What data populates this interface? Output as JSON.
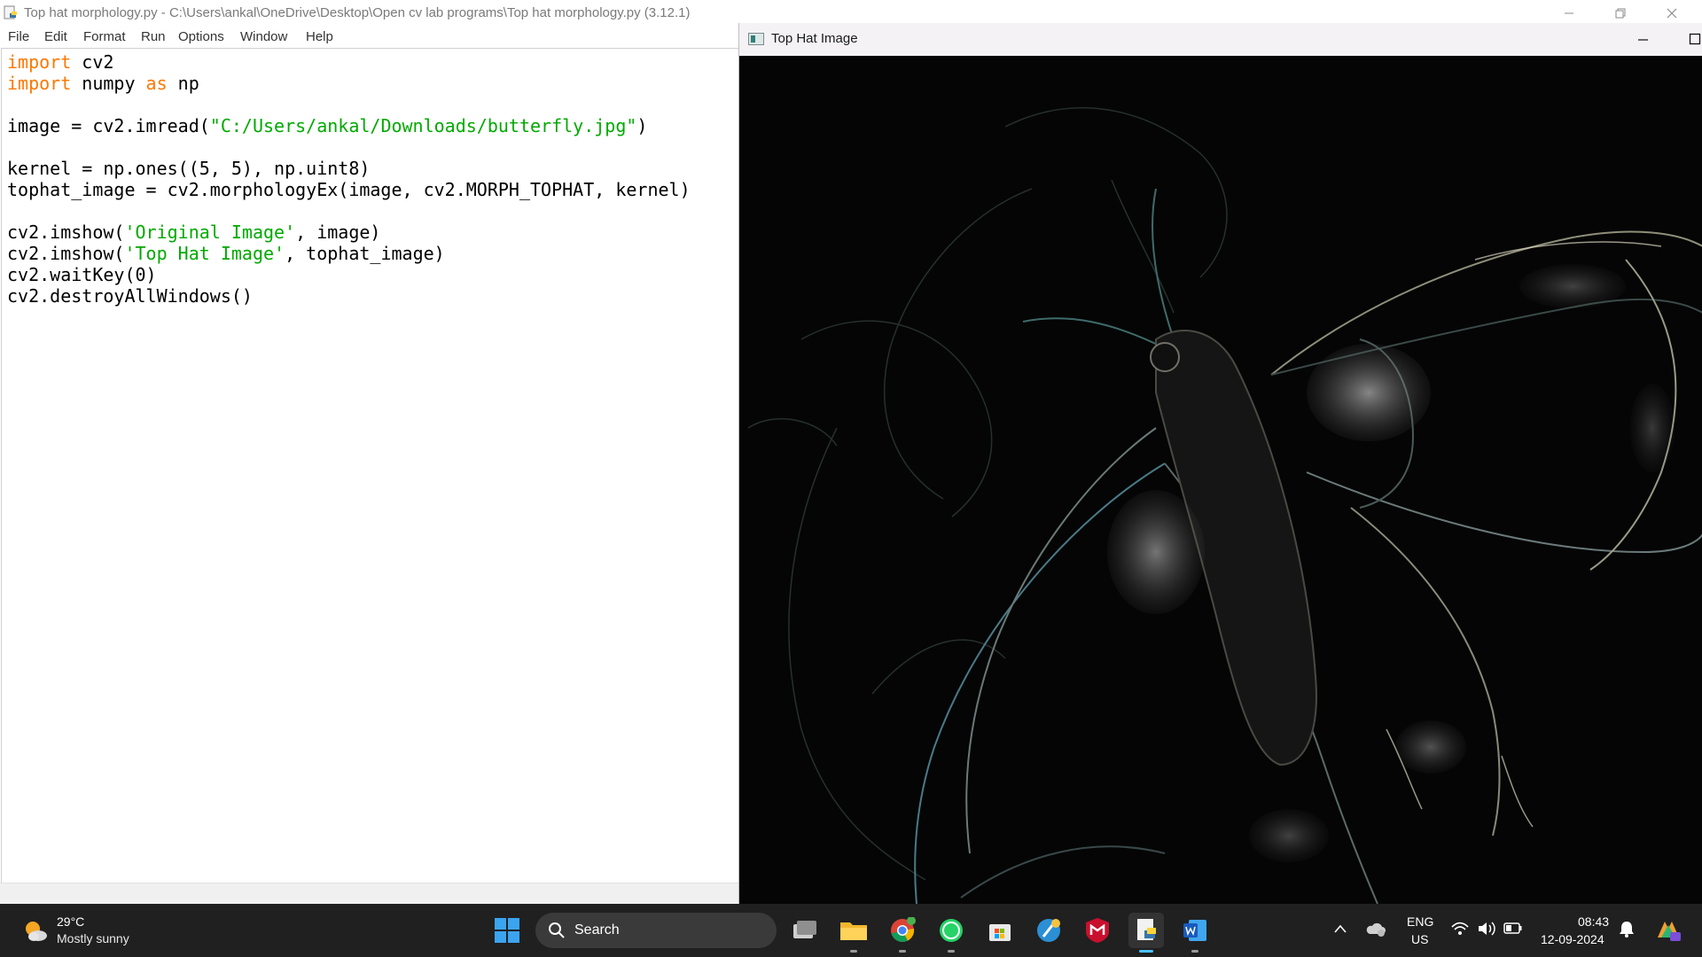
{
  "editor_window": {
    "title": "Top hat morphology.py - C:\\Users\\ankal\\OneDrive\\Desktop\\Open cv lab programs\\Top hat morphology.py (3.12.1)",
    "menu": [
      "File",
      "Edit",
      "Format",
      "Run",
      "Options",
      "Window",
      "Help"
    ]
  },
  "code": {
    "line1_kw": "import",
    "line1_rest": " cv2",
    "line2_kw": "import",
    "line2_mid": " numpy ",
    "line2_kw2": "as",
    "line2_rest": " np",
    "line4_a": "image = cv2.imread(",
    "line4_str": "\"C:/Users/ankal/Downloads/butterfly.jpg\"",
    "line4_b": ")",
    "line6": "kernel = np.ones((5, 5), np.uint8)",
    "line7": "tophat_image = cv2.morphologyEx(image, cv2.MORPH_TOPHAT, kernel)",
    "line9_a": "cv2.imshow(",
    "line9_str": "'Original Image'",
    "line9_b": ", image)",
    "line10_a": "cv2.imshow(",
    "line10_str": "'Top Hat Image'",
    "line10_b": ", tophat_image)",
    "line11": "cv2.waitKey(0)",
    "line12": "cv2.destroyAllWindows()"
  },
  "image_window": {
    "title": "Top Hat Image"
  },
  "taskbar": {
    "weather_temp": "29°C",
    "weather_desc": "Mostly sunny",
    "search_label": "Search",
    "apps": [
      "task-view",
      "file-explorer",
      "chrome",
      "whatsapp",
      "microsoft-store",
      "python-idle",
      "mcafee",
      "idle-editor",
      "word"
    ],
    "lang_top": "ENG",
    "lang_bottom": "US",
    "time": "08:43",
    "date": "12-09-2024"
  },
  "colors": {
    "keyword": "#ff7700",
    "string": "#00aa00",
    "taskbar_bg": "#202020",
    "image_bg": "#050505"
  }
}
